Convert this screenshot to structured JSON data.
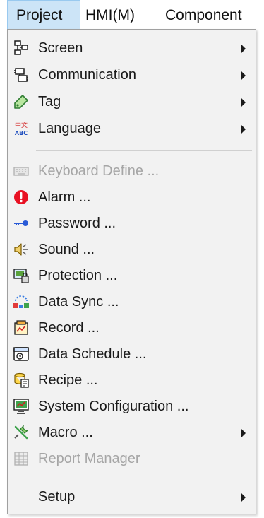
{
  "menubar": {
    "project": "Project",
    "hmi": "HMI(M)",
    "component": "Component"
  },
  "menu": {
    "items": [
      {
        "label": "Screen",
        "icon": "screen-icon",
        "enabled": true,
        "submenu": true
      },
      {
        "label": "Communication",
        "icon": "communication-icon",
        "enabled": true,
        "submenu": true
      },
      {
        "label": "Tag",
        "icon": "tag-icon",
        "enabled": true,
        "submenu": true
      },
      {
        "label": "Language",
        "icon": "language-icon",
        "enabled": true,
        "submenu": true
      },
      {
        "label": "Keyboard Define ...",
        "icon": "keyboard-icon",
        "enabled": false,
        "submenu": false
      },
      {
        "label": "Alarm ...",
        "icon": "alarm-icon",
        "enabled": true,
        "submenu": false
      },
      {
        "label": "Password ...",
        "icon": "password-key-icon",
        "enabled": true,
        "submenu": false
      },
      {
        "label": "Sound ...",
        "icon": "sound-icon",
        "enabled": true,
        "submenu": false
      },
      {
        "label": "Protection ...",
        "icon": "protection-icon",
        "enabled": true,
        "submenu": false
      },
      {
        "label": "Data Sync ...",
        "icon": "data-sync-icon",
        "enabled": true,
        "submenu": false
      },
      {
        "label": "Record ...",
        "icon": "record-icon",
        "enabled": true,
        "submenu": false
      },
      {
        "label": "Data Schedule ...",
        "icon": "data-schedule-icon",
        "enabled": true,
        "submenu": false
      },
      {
        "label": "Recipe ...",
        "icon": "recipe-icon",
        "enabled": true,
        "submenu": false
      },
      {
        "label": "System Configuration ...",
        "icon": "system-configuration-icon",
        "enabled": true,
        "submenu": false
      },
      {
        "label": "Macro ...",
        "icon": "macro-icon",
        "enabled": true,
        "submenu": true
      },
      {
        "label": "Report Manager",
        "icon": "report-manager-icon",
        "enabled": false,
        "submenu": false
      },
      {
        "label": "Setup",
        "icon": "",
        "enabled": true,
        "submenu": true
      }
    ],
    "language_icon_text": {
      "top": "中文",
      "bottom": "ABC"
    }
  },
  "colors": {
    "menu_background": "#f2f2f2",
    "active_menubar_highlight": "#cce4f7",
    "disabled_text": "#a6a6a6",
    "alarm_red": "#e81123"
  }
}
